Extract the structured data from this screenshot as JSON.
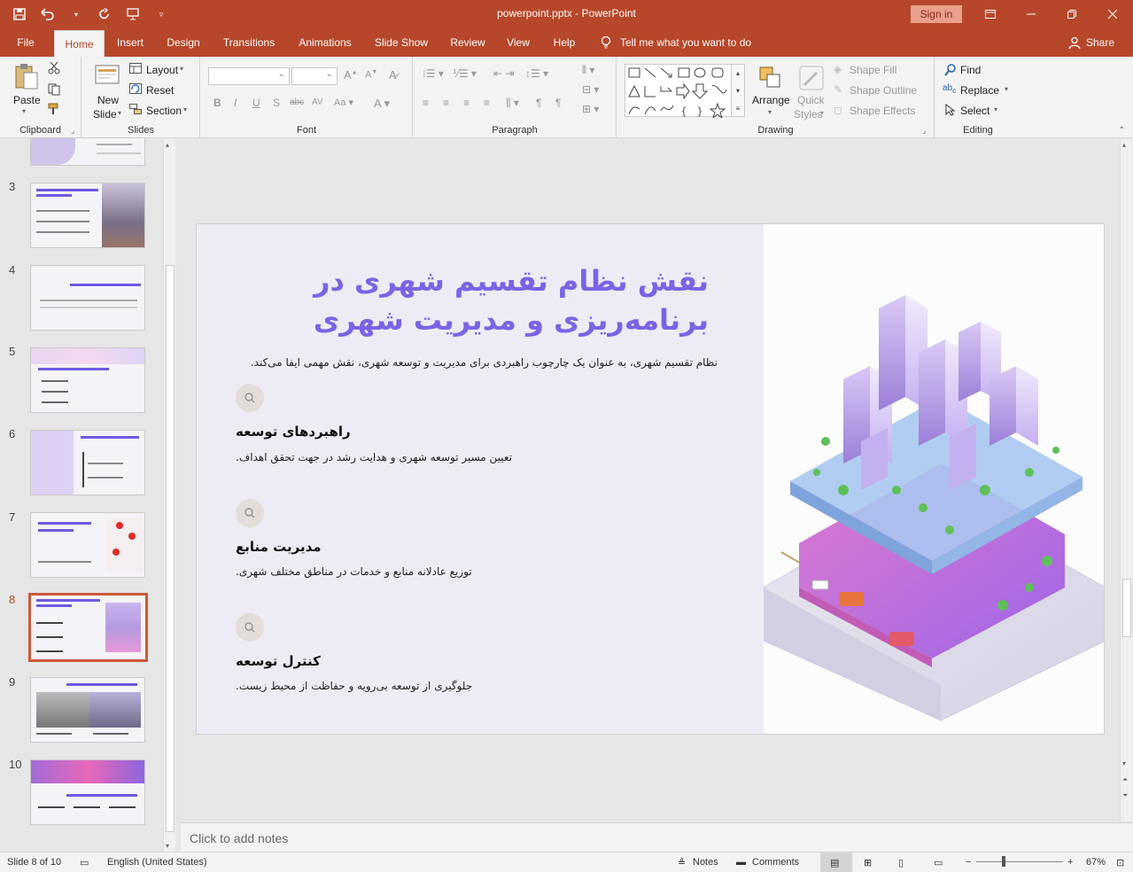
{
  "window": {
    "title": "powerpoint.pptx  -  PowerPoint",
    "signin": "Sign in"
  },
  "menu": {
    "tabs": [
      "File",
      "Home",
      "Insert",
      "Design",
      "Transitions",
      "Animations",
      "Slide Show",
      "Review",
      "View",
      "Help"
    ],
    "active_tab": "Home",
    "tellme": "Tell me what you want to do",
    "share": "Share"
  },
  "ribbon": {
    "clipboard": {
      "label": "Clipboard",
      "paste": "Paste"
    },
    "slides": {
      "label": "Slides",
      "new_slide_1": "New",
      "new_slide_2": "Slide",
      "layout": "Layout",
      "reset": "Reset",
      "section": "Section"
    },
    "font": {
      "label": "Font"
    },
    "paragraph": {
      "label": "Paragraph"
    },
    "drawing": {
      "label": "Drawing",
      "arrange": "Arrange",
      "quick_1": "Quick",
      "quick_2": "Styles",
      "shape_fill": "Shape Fill",
      "shape_outline": "Shape Outline",
      "shape_effects": "Shape Effects"
    },
    "editing": {
      "label": "Editing",
      "find": "Find",
      "replace": "Replace",
      "select": "Select"
    }
  },
  "thumbnails": [
    {
      "num": "3"
    },
    {
      "num": "4"
    },
    {
      "num": "5"
    },
    {
      "num": "6"
    },
    {
      "num": "7"
    },
    {
      "num": "8"
    },
    {
      "num": "9"
    },
    {
      "num": "10"
    }
  ],
  "slide": {
    "title": "نقش نظام تقسیم شهری در برنامه‌ریزی و مدیریت شهری",
    "subtitle": "نظام تقسیم شهری، به عنوان یک چارچوب راهبردی برای مدیریت و توسعه شهری، نقش مهمی ایفا می‌کند.",
    "features": [
      {
        "heading": "راهبردهای توسعه",
        "desc": "تعیین مسیر توسعه شهری و هدایت رشد در جهت تحقق اهداف."
      },
      {
        "heading": "مدیریت منابع",
        "desc": "توزیع عادلانه منابع و خدمات در مناطق مختلف شهری."
      },
      {
        "heading": "کنترل توسعه",
        "desc": "جلوگیری از توسعه بی‌رویه و حفاظت از محیط زیست."
      }
    ]
  },
  "notes": {
    "placeholder": "Click to add notes"
  },
  "status": {
    "slide": "Slide 8 of 10",
    "language": "English (United States)",
    "notes": "Notes",
    "comments": "Comments",
    "zoom": "67%"
  },
  "colors": {
    "accent": "#b7472a",
    "title_purple": "#7b63e6"
  }
}
